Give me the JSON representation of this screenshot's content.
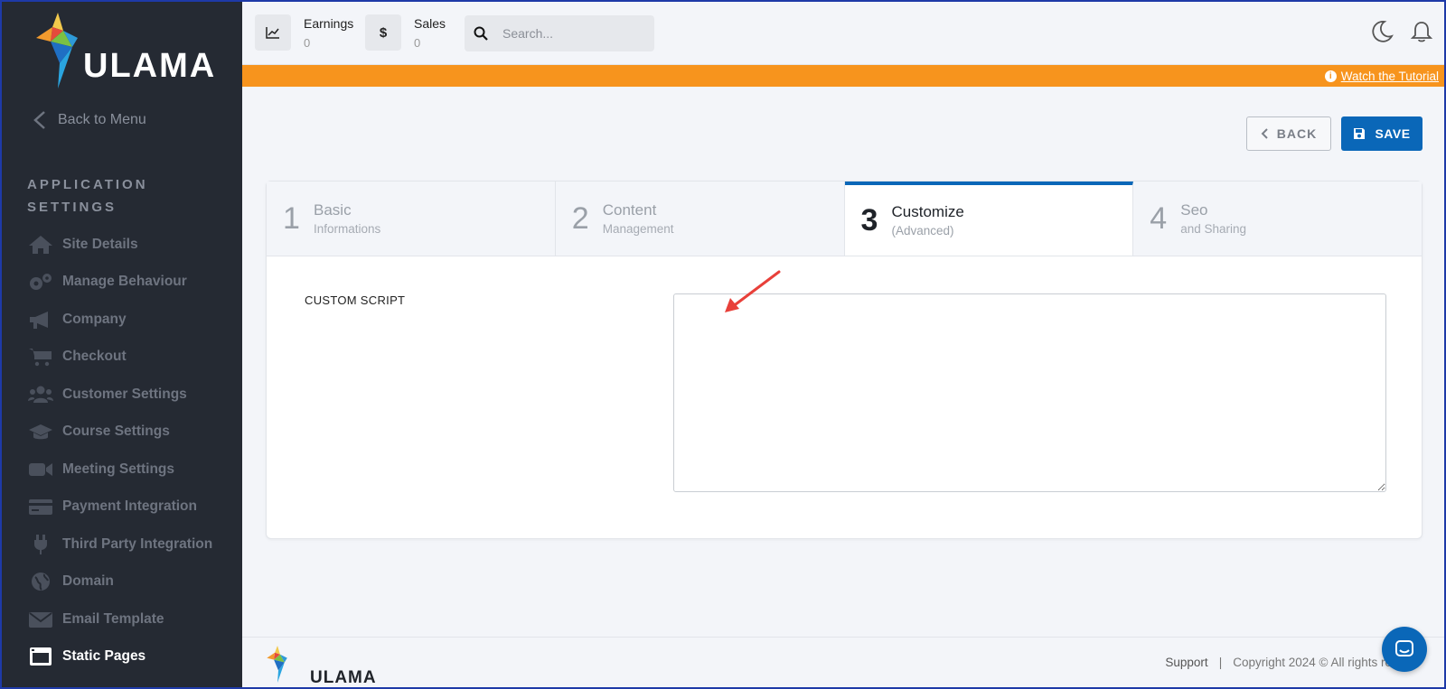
{
  "app": {
    "name": "ULAMA"
  },
  "sidebar": {
    "back_label": "Back to Menu",
    "section_title": "APPLICATION SETTINGS",
    "items": [
      {
        "label": "Site Details",
        "icon": "home-icon"
      },
      {
        "label": "Manage Behaviour",
        "icon": "gears-icon"
      },
      {
        "label": "Company",
        "icon": "megaphone-icon"
      },
      {
        "label": "Checkout",
        "icon": "cart-icon"
      },
      {
        "label": "Customer Settings",
        "icon": "users-icon"
      },
      {
        "label": "Course Settings",
        "icon": "graduation-cap-icon"
      },
      {
        "label": "Meeting Settings",
        "icon": "video-icon"
      },
      {
        "label": "Payment Integration",
        "icon": "credit-card-icon"
      },
      {
        "label": "Third Party Integration",
        "icon": "plug-icon"
      },
      {
        "label": "Domain",
        "icon": "globe-icon"
      },
      {
        "label": "Email Template",
        "icon": "envelope-icon"
      },
      {
        "label": "Static Pages",
        "icon": "window-icon",
        "active": true
      }
    ]
  },
  "topbar": {
    "earnings": {
      "label": "Earnings",
      "value": "0"
    },
    "sales": {
      "label": "Sales",
      "value": "0",
      "symbol": "$"
    },
    "search": {
      "placeholder": "Search..."
    }
  },
  "banner": {
    "link_label": "Watch the Tutorial",
    "color": "#f7941d"
  },
  "actions": {
    "back_label": "BACK",
    "save_label": "SAVE"
  },
  "steps": [
    {
      "num": "1",
      "title": "Basic",
      "subtitle": "Informations"
    },
    {
      "num": "2",
      "title": "Content",
      "subtitle": "Management"
    },
    {
      "num": "3",
      "title": "Customize",
      "subtitle": "(Advanced)",
      "active": true
    },
    {
      "num": "4",
      "title": "Seo",
      "subtitle": "and Sharing"
    }
  ],
  "form": {
    "custom_script_label": "CUSTOM SCRIPT",
    "custom_script_value": ""
  },
  "footer": {
    "support_label": "Support",
    "separator": "|",
    "copyright": "Copyright 2024 © All rights res..."
  },
  "colors": {
    "accent": "#0a67b8",
    "sidebar_bg": "#252a33",
    "banner": "#f7941d"
  }
}
